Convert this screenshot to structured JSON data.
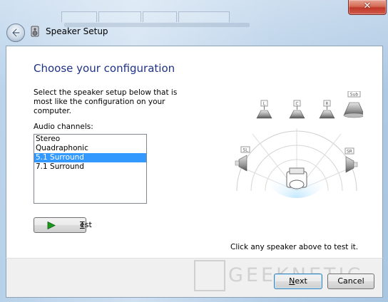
{
  "window": {
    "title": "Speaker Setup",
    "close_glyph": "✕"
  },
  "page": {
    "heading": "Choose your configuration",
    "description": "Select the speaker setup below that is most like the configuration on your computer.",
    "audio_channels_label": "Audio channels:",
    "channels": [
      {
        "label": "Stereo",
        "selected": false
      },
      {
        "label": "Quadraphonic",
        "selected": false
      },
      {
        "label": "5.1 Surround",
        "selected": true
      },
      {
        "label": "7.1 Surround",
        "selected": false
      }
    ],
    "test_button_mnemonic": "T",
    "test_button_rest": "est",
    "click_hint": "Click any speaker above to test it."
  },
  "speakers": {
    "labels": [
      "L",
      "C",
      "R",
      "Sub",
      "SL",
      "SR"
    ]
  },
  "footer": {
    "next_mnemonic": "N",
    "next_rest": "ext",
    "cancel_label": "Cancel"
  },
  "watermark": {
    "text": "GEEKNETIC"
  },
  "colors": {
    "heading": "#1e3287",
    "selection": "#3399ff",
    "test_arrow": "#1a9a1a"
  }
}
